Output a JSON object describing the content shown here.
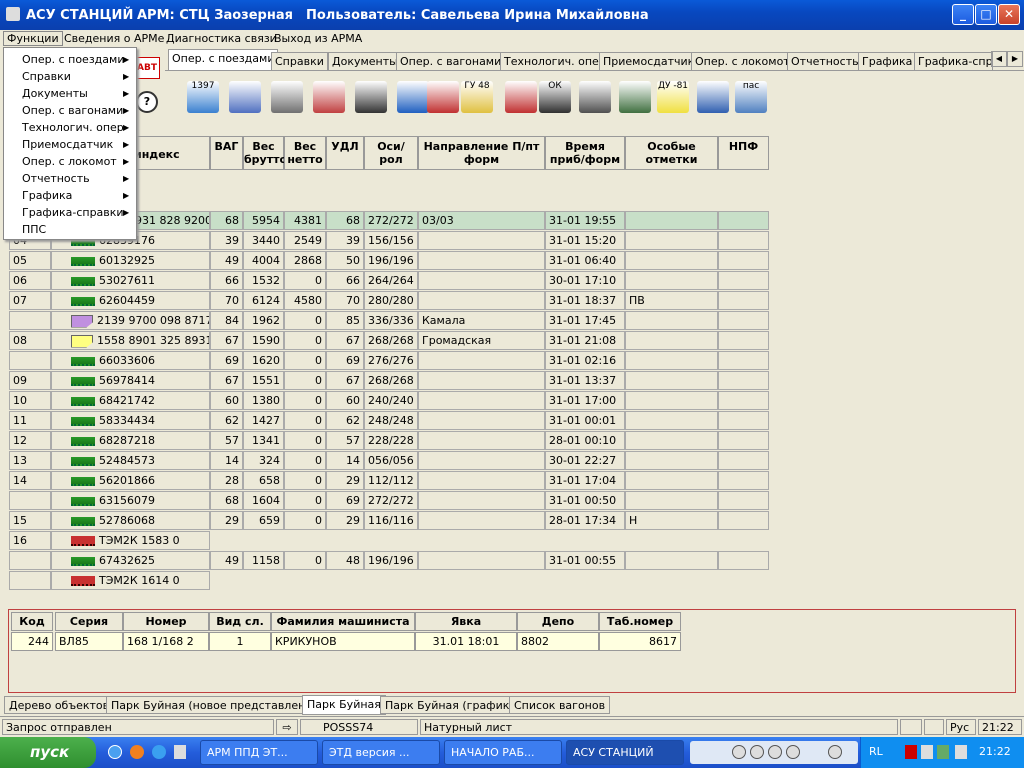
{
  "window": {
    "app_title": "АСУ СТАНЦИЙ",
    "arm": "АРМ: СТЦ Заозерная",
    "user": "Пользователь: Савельева Ирина Михайловна",
    "min": "_",
    "max": "□",
    "close": "✕"
  },
  "menu": {
    "items": [
      "Функции",
      "Сведения о АРМе",
      "Диагностика связи",
      "Выход из АРМА"
    ]
  },
  "dropdown": {
    "items": [
      "Опер. с поездами",
      "Справки",
      "Документы",
      "Опер. с вагонами",
      "Технологич. опер",
      "Приемосдатчик",
      "Опер. с локомот",
      "Отчетность",
      "Графика",
      "Графика-справки",
      "ППС"
    ],
    "arrow": "▶"
  },
  "tabs": [
    "Опер. с поездами",
    "Справки",
    "Документы",
    "Опер. с вагонами",
    "Технологич. опер",
    "Приемосдатчик",
    "Опер. с локомот",
    "Отчетность",
    "Графика",
    "Графика-спра"
  ],
  "scroll": {
    "left": "◀",
    "right": "▶"
  },
  "toolbar": {
    "icons": [
      "1397",
      "",
      "",
      "",
      "",
      "",
      "",
      "ГУ 48",
      "",
      "ОК",
      "",
      "",
      "ДУ -81",
      "",
      "пас"
    ]
  },
  "left_icon": "АВТ",
  "table": {
    "headers": [
      "индекс",
      "ВАГ",
      "Вес брутто",
      "Вес нетто",
      "УДЛ",
      "Оси/ рол",
      "Направление П/пт форм",
      "Время приб/форм",
      "Особые отметки",
      "НПФ"
    ],
    "rows": [
      {
        "n": "",
        "icon": "",
        "idx": "931 828 9200",
        "vag": "68",
        "br": "5954",
        "net": "4381",
        "udl": "68",
        "osi": "272/272",
        "dir": "03/03",
        "time": "31-01 19:55",
        "note": ""
      },
      {
        "n": "04",
        "icon": "wag",
        "idx": "62839176",
        "vag": "39",
        "br": "3440",
        "net": "2549",
        "udl": "39",
        "osi": "156/156",
        "dir": "",
        "time": "31-01 15:20",
        "note": ""
      },
      {
        "n": "05",
        "icon": "wag",
        "idx": "60132925",
        "vag": "49",
        "br": "4004",
        "net": "2868",
        "udl": "50",
        "osi": "196/196",
        "dir": "",
        "time": "31-01 06:40",
        "note": ""
      },
      {
        "n": "06",
        "icon": "wag",
        "idx": "53027611",
        "vag": "66",
        "br": "1532",
        "net": "0",
        "udl": "66",
        "osi": "264/264",
        "dir": "",
        "time": "30-01 17:10",
        "note": ""
      },
      {
        "n": "07",
        "icon": "wag",
        "idx": "62604459",
        "vag": "70",
        "br": "6124",
        "net": "4580",
        "udl": "70",
        "osi": "280/280",
        "dir": "",
        "time": "31-01 18:37",
        "note": "ПВ"
      },
      {
        "n": "",
        "icon": "flag1",
        "idx": "2139 9700 098 8717",
        "vag": "84",
        "br": "1962",
        "net": "0",
        "udl": "85",
        "osi": "336/336",
        "dir": "Камала",
        "time": "31-01 17:45",
        "note": ""
      },
      {
        "n": "08",
        "icon": "flag2",
        "idx": "1558 8901 325 8931",
        "vag": "67",
        "br": "1590",
        "net": "0",
        "udl": "67",
        "osi": "268/268",
        "dir": "Громадская",
        "time": "31-01 21:08",
        "note": ""
      },
      {
        "n": "",
        "icon": "wag",
        "idx": "66033606",
        "vag": "69",
        "br": "1620",
        "net": "0",
        "udl": "69",
        "osi": "276/276",
        "dir": "",
        "time": "31-01 02:16",
        "note": ""
      },
      {
        "n": "09",
        "icon": "wag",
        "idx": "56978414",
        "vag": "67",
        "br": "1551",
        "net": "0",
        "udl": "67",
        "osi": "268/268",
        "dir": "",
        "time": "31-01 13:37",
        "note": ""
      },
      {
        "n": "10",
        "icon": "wag",
        "idx": "68421742",
        "vag": "60",
        "br": "1380",
        "net": "0",
        "udl": "60",
        "osi": "240/240",
        "dir": "",
        "time": "31-01 17:00",
        "note": ""
      },
      {
        "n": "11",
        "icon": "wag",
        "idx": "58334434",
        "vag": "62",
        "br": "1427",
        "net": "0",
        "udl": "62",
        "osi": "248/248",
        "dir": "",
        "time": "31-01 00:01",
        "note": ""
      },
      {
        "n": "12",
        "icon": "wag",
        "idx": "68287218",
        "vag": "57",
        "br": "1341",
        "net": "0",
        "udl": "57",
        "osi": "228/228",
        "dir": "",
        "time": "28-01 00:10",
        "note": ""
      },
      {
        "n": "13",
        "icon": "wag",
        "idx": "52484573",
        "vag": "14",
        "br": "324",
        "net": "0",
        "udl": "14",
        "osi": "056/056",
        "dir": "",
        "time": "30-01 22:27",
        "note": ""
      },
      {
        "n": "14",
        "icon": "wag",
        "idx": "56201866",
        "vag": "28",
        "br": "658",
        "net": "0",
        "udl": "29",
        "osi": "112/112",
        "dir": "",
        "time": "31-01 17:04",
        "note": ""
      },
      {
        "n": "",
        "icon": "wag",
        "idx": "63156079",
        "vag": "68",
        "br": "1604",
        "net": "0",
        "udl": "69",
        "osi": "272/272",
        "dir": "",
        "time": "31-01 00:50",
        "note": ""
      },
      {
        "n": "15",
        "icon": "wag",
        "idx": "52786068",
        "vag": "29",
        "br": "659",
        "net": "0",
        "udl": "29",
        "osi": "116/116",
        "dir": "",
        "time": "28-01 17:34",
        "note": "Н"
      },
      {
        "n": "16",
        "icon": "loco",
        "idx": "ТЭМ2К 1583 0",
        "vag": null,
        "br": "",
        "net": "",
        "udl": "",
        "osi": "",
        "dir": "",
        "time": "",
        "note": ""
      },
      {
        "n": "",
        "icon": "wag",
        "idx": "67432625",
        "vag": "49",
        "br": "1158",
        "net": "0",
        "udl": "48",
        "osi": "196/196",
        "dir": "",
        "time": "31-01 00:55",
        "note": ""
      },
      {
        "n": "",
        "icon": "loco",
        "idx": "ТЭМ2К 1614 0",
        "vag": null,
        "br": "",
        "net": "",
        "udl": "",
        "osi": "",
        "dir": "",
        "time": "",
        "note": ""
      }
    ]
  },
  "lower": {
    "headers": [
      "Код",
      "Серия",
      "Номер",
      "Вид сл.",
      "Фамилия машиниста",
      "Явка",
      "Депо",
      "Таб.номер"
    ],
    "values": [
      "244",
      "ВЛ85",
      "168 1/168 2",
      "1",
      "КРИКУНОВ",
      "31.01 18:01",
      "8802",
      "8617"
    ]
  },
  "bottom_tabs": [
    "Дерево объектов",
    "Парк Буйная (новое представление)",
    "Парк Буйная",
    "Парк Буйная (графика)",
    "Список вагонов"
  ],
  "status": {
    "text": "Запрос отправлен",
    "arrow": "⇨",
    "code": "POSSS74",
    "sheet": "Натурный лист",
    "lang": "Рус",
    "time": "21:22"
  },
  "taskbar": {
    "start": "пуск",
    "tasks": [
      "АРМ ППД ЭТ...",
      "ЭТД версия ...",
      "НАЧАЛО РАБ...",
      "АСУ СТАНЦИЙ"
    ],
    "lang": "RL",
    "clock": "21:22"
  }
}
